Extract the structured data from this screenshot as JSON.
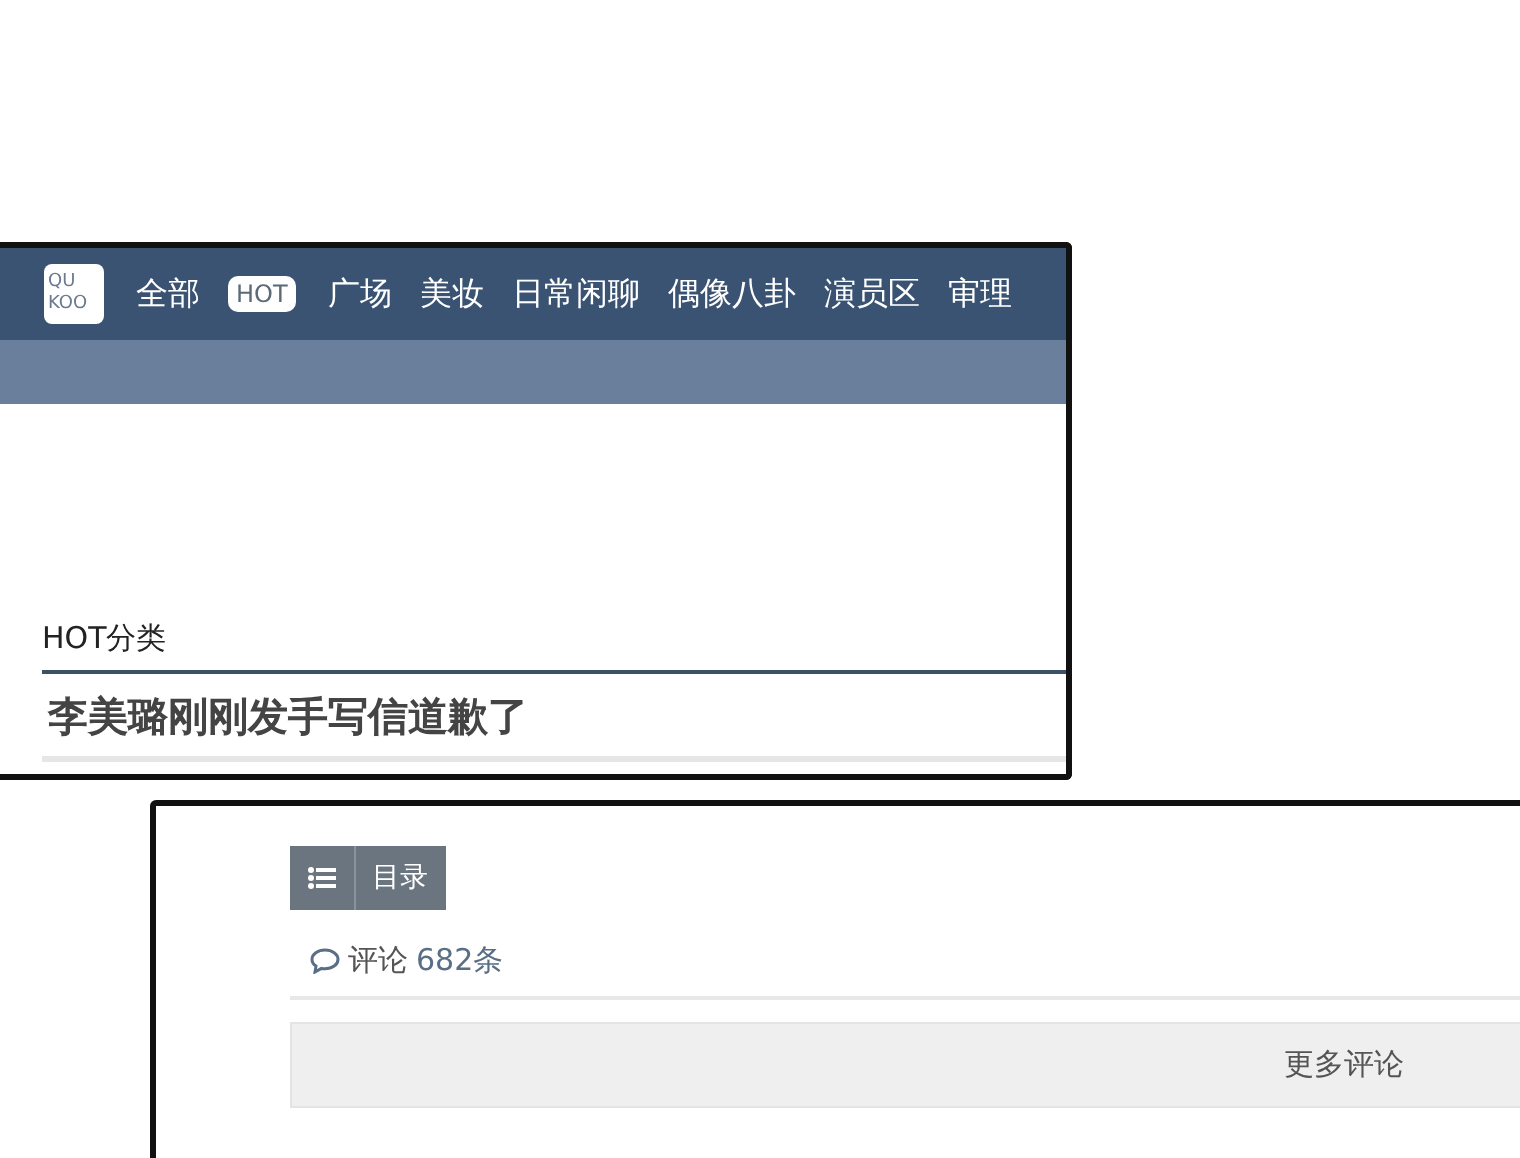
{
  "top_panel": {
    "logo": [
      "QU",
      "KOO"
    ],
    "nav": [
      {
        "label": "全部",
        "selected": false
      },
      {
        "label": "HOT",
        "selected": true
      },
      {
        "label": "广场",
        "selected": false
      },
      {
        "label": "美妆",
        "selected": false
      },
      {
        "label": "日常闲聊",
        "selected": false
      },
      {
        "label": "偶像八卦",
        "selected": false
      },
      {
        "label": "演员区",
        "selected": false
      },
      {
        "label": "审理",
        "selected": false
      }
    ],
    "section_label": "HOT分类",
    "headline": "李美璐刚刚发手写信道歉了"
  },
  "bottom_panel": {
    "toc_button": "目录",
    "comments_label": "评论",
    "comments_count": "682条",
    "more_comments": "更多评论"
  }
}
